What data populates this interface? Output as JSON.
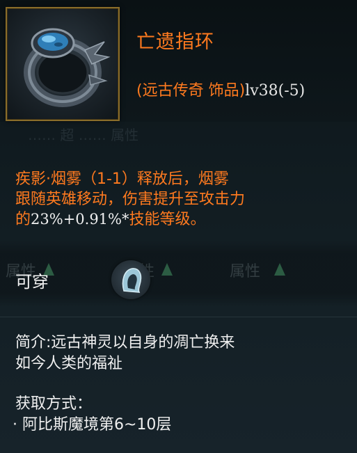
{
  "item": {
    "name": "亡遗指环",
    "category": "(远古传奇 饰品)",
    "level": "lv38(-5)",
    "icon": "ring-icon"
  },
  "background_ghost": {
    "row": "…… 超 …… 属性",
    "attr1": "属性",
    "attr2": "性",
    "attr3": "属性"
  },
  "effect": {
    "line1": "疾影·烟雾（1-1）释放后，烟雾",
    "line2": "跟随英雄移动，伤害提升至攻击力",
    "line3_prefix": "的",
    "line3_value": "23%+0.91%*",
    "line3_suffix": "技能等级。"
  },
  "wear": {
    "label": "可穿",
    "icon": "hood-icon"
  },
  "intro": {
    "line1": "简介:远古神灵以自身的凋亡换来",
    "line2": "如今人类的福祉"
  },
  "obtain": {
    "title": "获取方式：",
    "item": "· 阿比斯魔境第6~10层"
  },
  "colors": {
    "legendary_orange": "#ff7a1f",
    "text_white": "#f0f0f0",
    "frame_gold": "#8a6d2a"
  }
}
